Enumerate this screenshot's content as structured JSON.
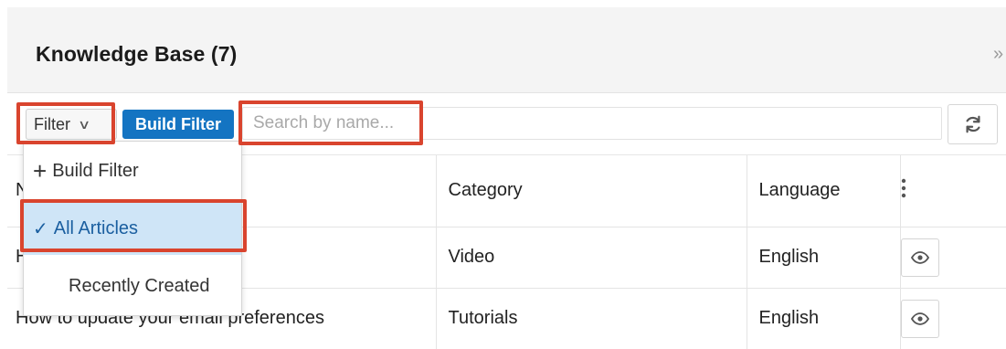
{
  "header": {
    "title": "Knowledge Base (7)",
    "collapse_glyph": "»"
  },
  "toolbar": {
    "filter_label": "Filter",
    "filter_chevron_glyph": "∨",
    "build_filter_label": "Build Filter",
    "search_placeholder": "Search by name...",
    "refresh_icon": "refresh-icon"
  },
  "table": {
    "columns": [
      "Category",
      "Language"
    ],
    "header_name_visible": "N",
    "rows": [
      {
        "name_visible": "H",
        "category": "Video",
        "language": "English",
        "action_icon": "eye-icon"
      },
      {
        "name": "How to update your email preferences",
        "category": "Tutorials",
        "language": "English",
        "action_icon": "eye-icon"
      }
    ]
  },
  "filter_dropdown": {
    "items": [
      {
        "label": "Build Filter",
        "icon": "plus-icon"
      },
      {
        "label": "All Articles",
        "icon": "check-icon",
        "selected": true
      },
      {
        "label": "Recently Created"
      }
    ]
  },
  "colors": {
    "accent_button": "#1474c2",
    "link": "#1d6fbf",
    "highlight_outline": "#d9442e",
    "selected_item_bg": "#cfe5f7"
  }
}
